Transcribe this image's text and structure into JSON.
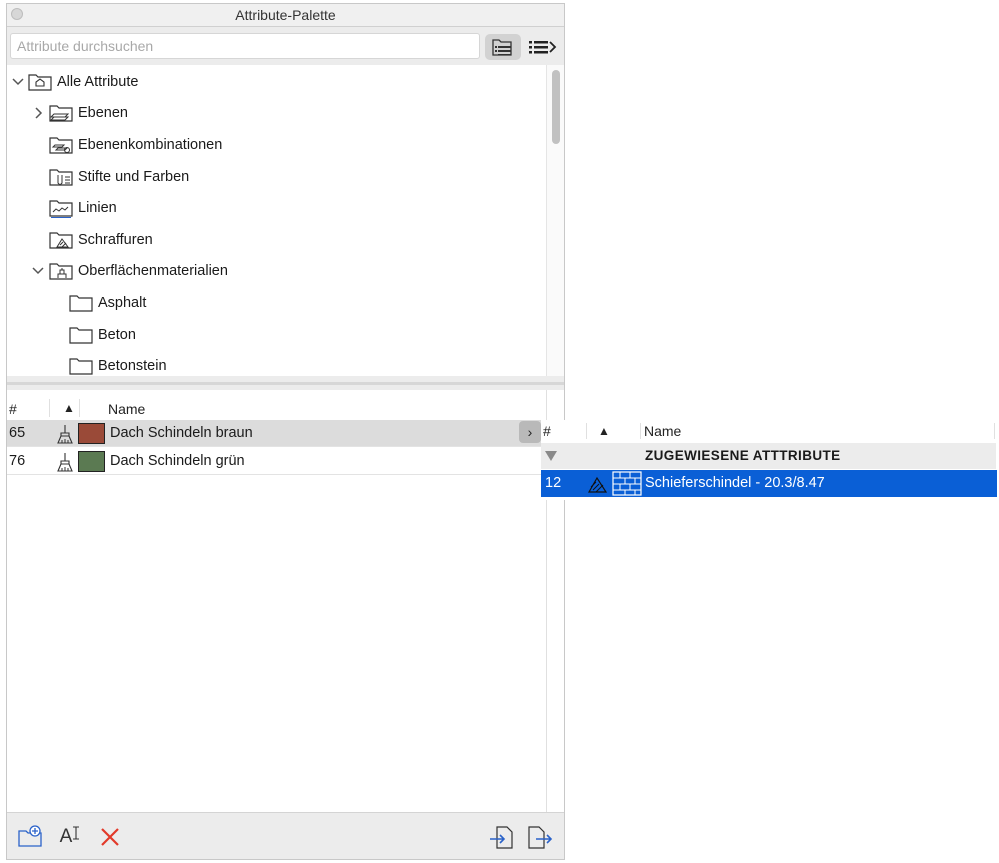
{
  "window": {
    "title": "Attribute-Palette"
  },
  "search": {
    "placeholder": "Attribute durchsuchen"
  },
  "tree": {
    "items": [
      {
        "label": "Alle Attribute",
        "expanded": true,
        "icon": "folder-home-icon"
      },
      {
        "label": "Ebenen",
        "expanded": false,
        "icon": "folder-layers-icon"
      },
      {
        "label": "Ebenenkombinationen",
        "icon": "folder-layer-combinations-icon"
      },
      {
        "label": "Stifte und Farben",
        "icon": "folder-pens-icon"
      },
      {
        "label": "Linien",
        "icon": "folder-lines-icon"
      },
      {
        "label": "Schraffuren",
        "icon": "folder-fills-icon"
      },
      {
        "label": "Oberflächenmaterialien",
        "expanded": true,
        "icon": "folder-surfaces-icon"
      },
      {
        "label": "Asphalt",
        "icon": "folder-icon"
      },
      {
        "label": "Beton",
        "icon": "folder-icon"
      },
      {
        "label": "Betonstein",
        "icon": "folder-icon"
      }
    ]
  },
  "list": {
    "headers": {
      "num": "#",
      "sort": "▲",
      "name": "Name"
    },
    "rows": [
      {
        "num": "65",
        "name": "Dach Schindeln braun",
        "color": "#9a4a38",
        "selected": true
      },
      {
        "num": "76",
        "name": "Dach Schindeln grün",
        "color": "#5b7a52",
        "selected": false
      }
    ]
  },
  "details": {
    "expand_label": "›",
    "headers": {
      "num": "#",
      "sort": "▲",
      "name": "Name"
    },
    "group": {
      "label": "ZUGEWIESENE ATTTRIBUTE"
    },
    "rows": [
      {
        "num": "12",
        "name": "Schieferschindel - 20.3/8.47"
      }
    ]
  },
  "toolbar": {
    "new_folder": "new-folder-icon",
    "rename": "A",
    "delete": "delete-icon",
    "import": "import-icon",
    "export": "export-icon"
  },
  "colors": {
    "selection": "#0a5fd6",
    "delete": "#e23a2a",
    "accent": "#2a62c9"
  }
}
